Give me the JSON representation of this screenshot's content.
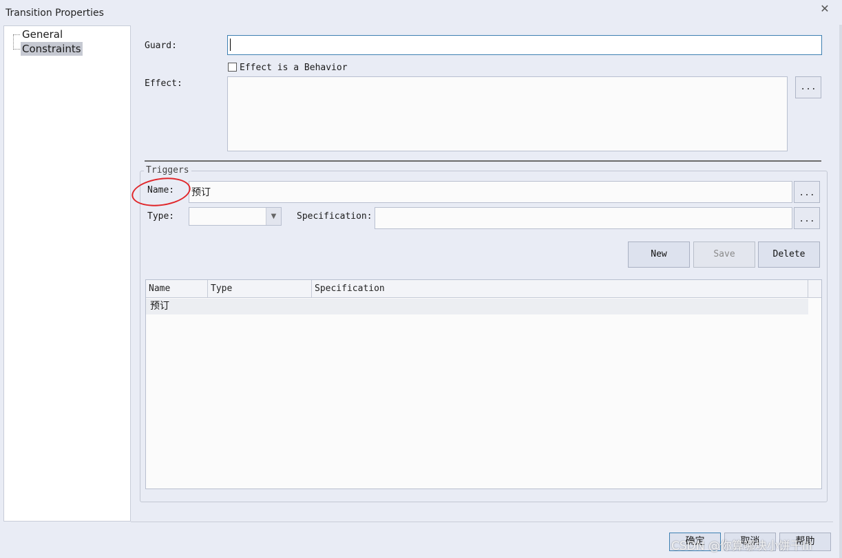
{
  "window": {
    "title": "Transition Properties",
    "close_glyph": "✕"
  },
  "tree": {
    "items": [
      {
        "label": "General"
      },
      {
        "label": "Constraints",
        "selected": true
      }
    ]
  },
  "form": {
    "guard_label": "Guard:",
    "guard_value": "",
    "effect_checkbox_label": "Effect is a Behavior",
    "effect_checked": false,
    "effect_label": "Effect:",
    "effect_value": "",
    "browse_label": "..."
  },
  "triggers": {
    "group_title": "Triggers",
    "name_label": "Name:",
    "name_value": "预订",
    "type_label": "Type:",
    "type_value": "",
    "spec_label": "Specification:",
    "spec_value": "",
    "browse_label": "...",
    "buttons": {
      "new": "New",
      "save": "Save",
      "delete": "Delete"
    },
    "table": {
      "columns": [
        "Name",
        "Type",
        "Specification"
      ],
      "rows": [
        {
          "name": "预订",
          "type": "",
          "specification": ""
        }
      ]
    }
  },
  "footer": {
    "ok": "确定",
    "cancel": "取消",
    "help": "帮助"
  },
  "watermark": "CSDN @你算哪块小饼干III",
  "colors": {
    "background": "#e9ecf5",
    "focus_border": "#3c7fb1",
    "annotation": "#e0262a"
  },
  "icons": {
    "close": "close-icon",
    "dropdown": "chevron-down-icon"
  }
}
